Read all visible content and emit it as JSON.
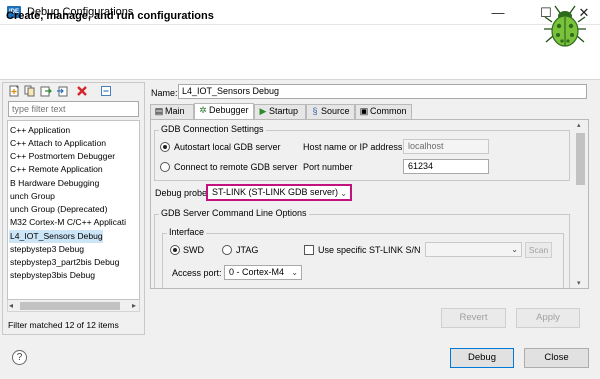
{
  "window": {
    "title": "Debug Configurations",
    "app_icon_text": "IDE",
    "minimize": "—",
    "maximize": "☐",
    "close": "✕"
  },
  "header": {
    "title": "Create, manage, and run configurations",
    "icon": "bug-icon"
  },
  "left": {
    "toolbar": [
      "new-config-icon",
      "duplicate-icon",
      "export-icon",
      "import-icon",
      "delete-icon",
      "collapse-all-icon"
    ],
    "filter_placeholder": "type filter text",
    "items": [
      {
        "label": "C++ Application",
        "selected": false
      },
      {
        "label": "C++ Attach to Application",
        "selected": false
      },
      {
        "label": "C++ Postmortem Debugger",
        "selected": false
      },
      {
        "label": "C++ Remote Application",
        "selected": false
      },
      {
        "label": "B Hardware Debugging",
        "selected": false
      },
      {
        "label": "unch Group",
        "selected": false
      },
      {
        "label": "unch Group (Deprecated)",
        "selected": false
      },
      {
        "label": "M32 Cortex-M C/C++ Applicati",
        "selected": false
      },
      {
        "label": "L4_IOT_Sensors Debug",
        "selected": true
      },
      {
        "label": "stepbystep3 Debug",
        "selected": false
      },
      {
        "label": "stepbystep3_part2bis Debug",
        "selected": false
      },
      {
        "label": "stepbystep3bis Debug",
        "selected": false
      }
    ],
    "status": "Filter matched 12 of 12 items"
  },
  "right": {
    "name_label": "Name:",
    "name_value": "L4_IOT_Sensors Debug",
    "tabs": [
      {
        "label": "Main",
        "icon": "main-tab-icon",
        "active": false
      },
      {
        "label": "Debugger",
        "icon": "debugger-tab-icon",
        "active": true
      },
      {
        "label": "Startup",
        "icon": "startup-tab-icon",
        "active": false
      },
      {
        "label": "Source",
        "icon": "source-tab-icon",
        "active": false
      },
      {
        "label": "Common",
        "icon": "common-tab-icon",
        "active": false
      }
    ],
    "gdb": {
      "group_title": "GDB Connection Settings",
      "autostart_label": "Autostart local GDB server",
      "autostart_selected": true,
      "remote_label": "Connect to remote GDB server",
      "remote_selected": false,
      "host_label": "Host name or IP address",
      "host_value": "localhost",
      "port_label": "Port number",
      "port_value": "61234"
    },
    "probe": {
      "label": "Debug probe",
      "value": "ST-LINK (ST-LINK GDB server)",
      "highlight_color": "#c2127f"
    },
    "server_options": {
      "group_title": "GDB Server Command Line Options",
      "interface_title": "Interface",
      "swd_label": "SWD",
      "swd_selected": true,
      "jtag_label": "JTAG",
      "jtag_selected": false,
      "use_sn_label": "Use specific ST-LINK S/N",
      "use_sn_checked": false,
      "sn_value": "",
      "scan_label": "Scan",
      "access_port_label": "Access port:",
      "access_port_value": "0 - Cortex-M4"
    },
    "revert_label": "Revert",
    "apply_label": "Apply"
  },
  "footer": {
    "help_label": "?",
    "debug_label": "Debug",
    "close_label": "Close"
  }
}
